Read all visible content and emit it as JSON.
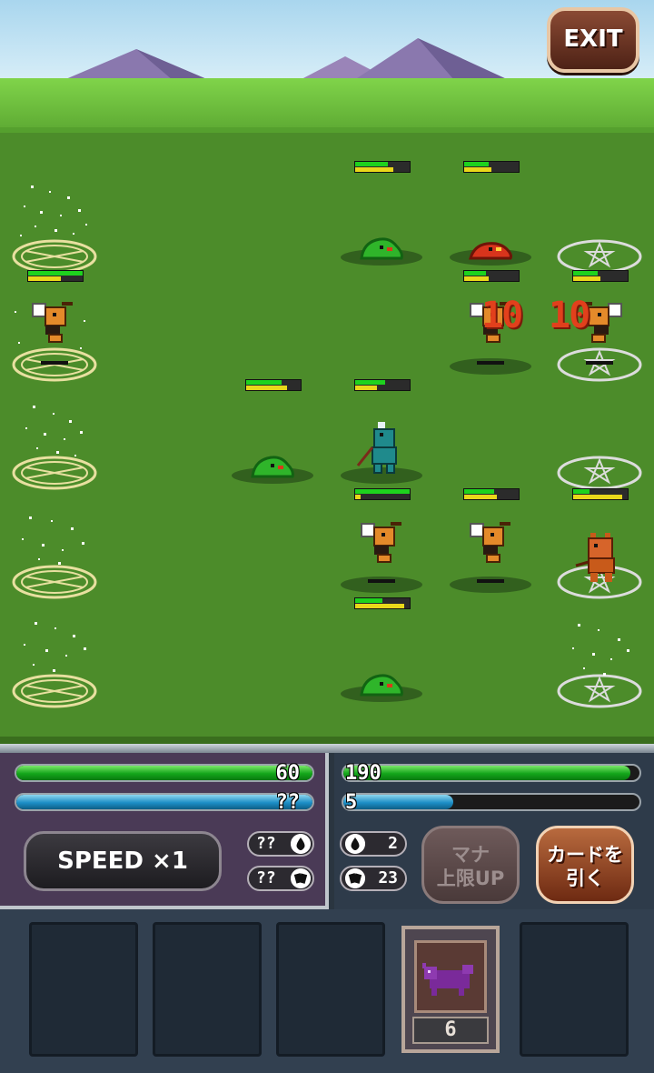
{
  "exit": {
    "label": "EXIT"
  },
  "damage_numbers": [
    "10",
    "10"
  ],
  "player": {
    "hp_text": "60",
    "hp_fraction": 1.0,
    "mana_text": "??",
    "mana_fraction": 1.0,
    "mana_count": "??",
    "deck_count": "??"
  },
  "enemy": {
    "hp_text": "190",
    "hp_fraction": 0.97,
    "mana_text": "5",
    "mana_fraction": 0.37,
    "mana_count": "2",
    "deck_count": "23"
  },
  "controls": {
    "speed_label": "SPEED ×1",
    "mana_limit_up_line1": "マナ",
    "mana_limit_up_line2": "上限UP",
    "draw_card_line1": "カードを",
    "draw_card_line2": "引く"
  },
  "hand": {
    "card_cost": "6"
  },
  "colors": {
    "hp_bar": "#13a51a",
    "mana_bar": "#1c8ec6",
    "damage_text": "#e2401c",
    "unit_hp": "#1ed21e",
    "unit_energy": "#e9d81a"
  },
  "units": [
    {
      "kind": "bee",
      "side": "player",
      "hp": 1.0,
      "energy": 0.6
    },
    {
      "kind": "slime-green",
      "side": "player",
      "hp": 0.6,
      "energy": 0.7
    },
    {
      "kind": "slime-red",
      "side": "player",
      "hp": 0.45,
      "energy": 0.5
    },
    {
      "kind": "bee",
      "side": "player",
      "hp": 0.4,
      "energy": 0.45
    },
    {
      "kind": "bee",
      "side": "enemy",
      "hp": 0.45,
      "energy": 0.5
    },
    {
      "kind": "slime-green",
      "side": "player",
      "hp": 0.65,
      "energy": 0.75
    },
    {
      "kind": "lizard-knight",
      "side": "player",
      "hp": 0.55,
      "energy": 0.4
    },
    {
      "kind": "bee",
      "side": "player",
      "hp": 1.0,
      "energy": 0.1
    },
    {
      "kind": "bee",
      "side": "player",
      "hp": 0.55,
      "energy": 0.6
    },
    {
      "kind": "imp",
      "side": "enemy",
      "hp": 0.3,
      "energy": 0.9
    },
    {
      "kind": "slime-green",
      "side": "player",
      "hp": 0.5,
      "energy": 0.9
    }
  ]
}
